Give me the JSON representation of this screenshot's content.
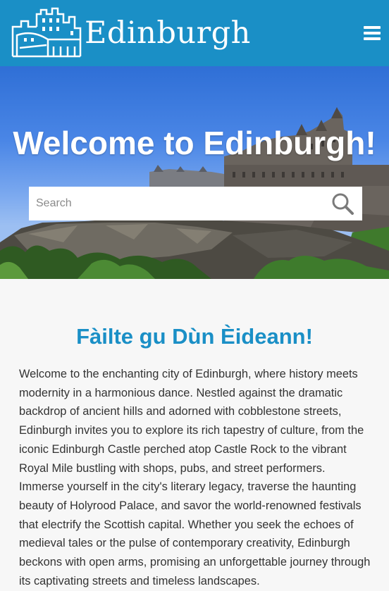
{
  "header": {
    "brand": "Edinburgh",
    "logo_icon": "castle-logo-icon",
    "menu_icon": "hamburger-menu-icon",
    "background_color": "#1a8fc6"
  },
  "hero": {
    "title": "Welcome to Edinburgh!",
    "search": {
      "placeholder": "Search",
      "value": "",
      "button_icon": "search-icon"
    }
  },
  "main": {
    "heading": "Fàilte gu Dùn Èideann!",
    "heading_color": "#1a8fc6",
    "intro": "Welcome to the enchanting city of Edinburgh, where history meets modernity in a harmonious dance. Nestled against the dramatic backdrop of ancient hills and adorned with cobblestone streets, Edinburgh invites you to explore its rich tapestry of culture, from the iconic Edinburgh Castle perched atop Castle Rock to the vibrant Royal Mile bustling with shops, pubs, and street performers. Immerse yourself in the city's literary legacy, traverse the haunting beauty of Holyrood Palace, and savor the world-renowned festivals that electrify the Scottish capital. Whether you seek the echoes of medieval tales or the pulse of contemporary creativity, Edinburgh beckons with open arms, promising an unforgettable journey through its captivating streets and timeless landscapes."
  }
}
